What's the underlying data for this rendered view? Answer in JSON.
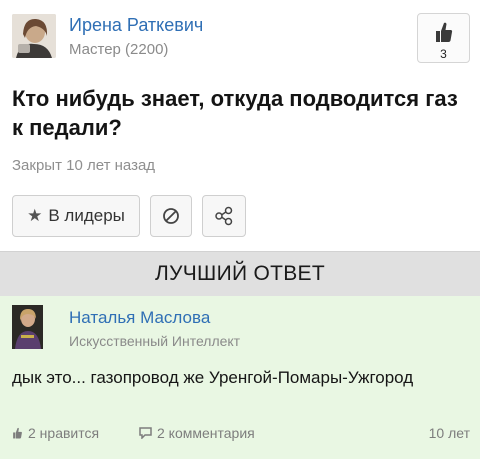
{
  "question": {
    "author_name": "Ирена Раткевич",
    "author_rank": "Мастер (2200)",
    "like_count": "3",
    "title": "Кто нибудь знает, откуда подводится газ к педали?",
    "closed_text": "Закрыт 10 лет назад",
    "leaders_button_label": "В лидеры",
    "icons": {
      "like": "thumbs-up-icon",
      "leaders": "star-icon",
      "block": "block-icon",
      "share": "share-icon"
    }
  },
  "best_answer_header": "ЛУЧШИЙ ОТВЕТ",
  "answer": {
    "author_name": "Наталья Маслова",
    "author_rank": "Искусственный Интеллект",
    "text": "дык это... газопровод же Уренгой-Помары-Ужгород",
    "likes_label": "2 нравится",
    "comments_label": "2 комментария",
    "time_label": "10 лет",
    "icons": {
      "likes": "thumbs-up-icon",
      "comments": "comment-icon"
    }
  },
  "colors": {
    "link_blue": "#2f6fb5",
    "answer_background": "#e9f7e3",
    "header_bar": "#e0e0e0",
    "muted_text": "#8a8a8a"
  }
}
